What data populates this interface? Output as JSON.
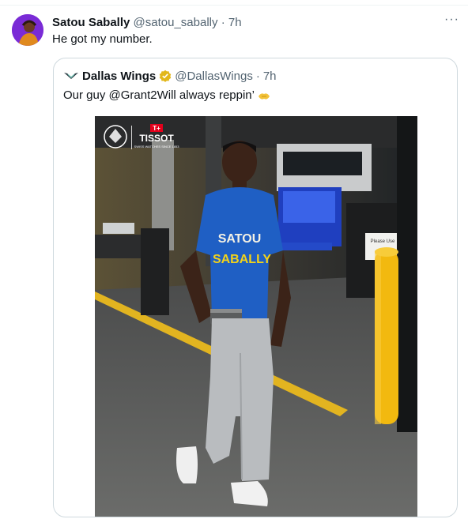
{
  "tweet": {
    "display_name": "Satou Sabally",
    "handle": "@satou_sabally",
    "separator": "·",
    "time": "7h",
    "text": "He got my number.",
    "more_label": "···"
  },
  "quoted": {
    "display_name": "Dallas Wings",
    "handle": "@DallasWings",
    "separator": "·",
    "time": "7h",
    "text": "Our guy @Grant2Will always reppin’",
    "verified_color": "#e2b719"
  },
  "photo": {
    "brand_logo": "TISSOT",
    "brand_tagline": "SWISS WATCHES SINCE 1853",
    "shirt_text_top": "SATOU",
    "shirt_text_bottom": "SABALLY",
    "sign_text": "Please Use"
  },
  "colors": {
    "shirt": "#1f5fc4",
    "pants": "#b9bcbf",
    "avatar_bg": "#7a2bd6"
  }
}
